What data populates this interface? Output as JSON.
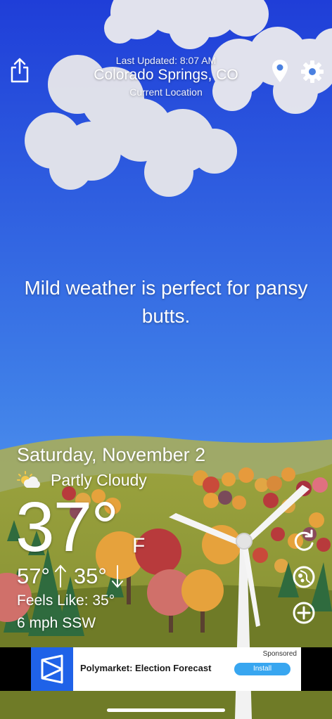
{
  "header": {
    "last_updated": "Last Updated: 8:07 AM",
    "city": "Colorado Springs, CO",
    "current_location": "Current Location",
    "share_icon": "share-icon",
    "location_icon": "map-pin-icon",
    "settings_icon": "gear-icon"
  },
  "message": "Mild weather is perfect for pansy butts.",
  "weather": {
    "date": "Saturday, November 2",
    "condition": "Partly Cloudy",
    "condition_icon": "partly-cloudy-icon",
    "temperature": "37°",
    "unit": "F",
    "high": "57°",
    "low": "35°",
    "feels_like": "Feels Like: 35°",
    "wind": "6 mph SSW"
  },
  "side_buttons": {
    "refresh_icon": "refresh-icon",
    "radar_icon": "radar-icon",
    "add_icon": "add-location-icon"
  },
  "ad": {
    "sponsored": "Sponsored",
    "title": "Polymarket: Election Forecast",
    "install": "Install"
  },
  "colors": {
    "sky_top": "#1f3ed8",
    "sky_bottom": "#5ea6f2",
    "hill": "#8f9a37",
    "ad_blue": "#1f62e8",
    "install_blue": "#38a6f0"
  }
}
